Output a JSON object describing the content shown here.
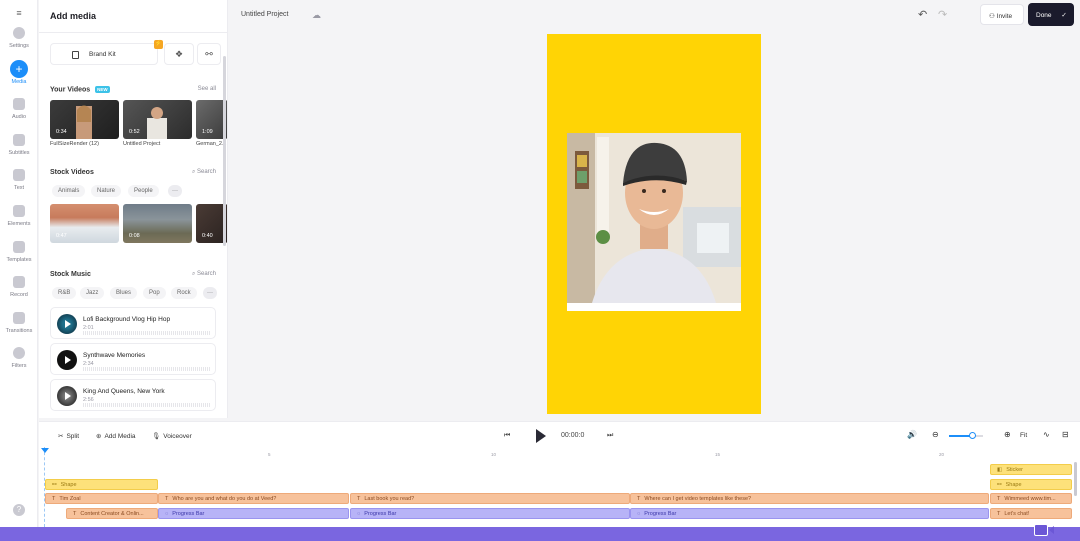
{
  "rail": {
    "items": [
      {
        "label": "Settings",
        "icon": "gear-icon"
      },
      {
        "label": "Media",
        "icon": "plus-icon",
        "active": true
      },
      {
        "label": "Audio",
        "icon": "music-note-icon"
      },
      {
        "label": "Subtitles",
        "icon": "subtitles-icon"
      },
      {
        "label": "Text",
        "icon": "text-icon"
      },
      {
        "label": "Elements",
        "icon": "shapes-icon"
      },
      {
        "label": "Templates",
        "icon": "template-icon"
      },
      {
        "label": "Record",
        "icon": "record-icon"
      },
      {
        "label": "Transitions",
        "icon": "transitions-icon"
      },
      {
        "label": "Filters",
        "icon": "filters-icon"
      }
    ],
    "menu_glyph": "≡",
    "help_glyph": "?"
  },
  "panel": {
    "title": "Add media",
    "brand_kit": "Brand Kit",
    "brand_kit_badge": "⚡",
    "your_videos": {
      "title": "Your Videos",
      "badge": "NEW",
      "see_all": "See all",
      "items": [
        {
          "duration": "0:34",
          "caption": "FullSizeRender (12)"
        },
        {
          "duration": "0:52",
          "caption": "Untitled Project"
        },
        {
          "duration": "1:09",
          "caption": "German_2..."
        }
      ]
    },
    "stock_videos": {
      "title": "Stock Videos",
      "search": "Search",
      "chips": [
        "Animals",
        "Nature",
        "People",
        "···"
      ],
      "items": [
        {
          "duration": "0:47"
        },
        {
          "duration": "0:08"
        },
        {
          "duration": "0:40"
        }
      ]
    },
    "stock_music": {
      "title": "Stock Music",
      "search": "Search",
      "chips": [
        "R&B",
        "Jazz",
        "Blues",
        "Pop",
        "Rock",
        "···"
      ],
      "tracks": [
        {
          "title": "Lofi Background Vlog Hip Hop",
          "duration": "2:01"
        },
        {
          "title": "Synthwave Memories",
          "duration": "2:34"
        },
        {
          "title": "King And Queens, New York",
          "duration": "2:56"
        }
      ]
    }
  },
  "topbar": {
    "project_name": "Untitled Project",
    "invite": "Invite",
    "done": "Done"
  },
  "timeline": {
    "split": "Split",
    "add_media": "Add Media",
    "voiceover": "Voiceover",
    "timecode": "00:00:0",
    "fit": "Fit",
    "zoom_level": 0.65,
    "ruler": [
      "0",
      "5",
      "10",
      "15",
      "20"
    ],
    "clips": {
      "shape_left": "Shape",
      "tim": "Tim Zoal",
      "who": "Who are you and what do you do at Veed?",
      "last": "Last book you read?",
      "where": "Where can I get video templates like these?",
      "creator": "Content Creator & Onlin...",
      "progress1": "Progress Bar",
      "progress2": "Progress Bar",
      "progress3": "Progress Bar",
      "sticker": "Sticker",
      "shape_right": "Shape",
      "url": "Wimmeed www.tim...",
      "chat": "Let's chat!"
    }
  },
  "colors": {
    "accent": "#1c8ef9",
    "canvas_bg": "#ffd405",
    "done_bg": "#1a1a2c"
  }
}
